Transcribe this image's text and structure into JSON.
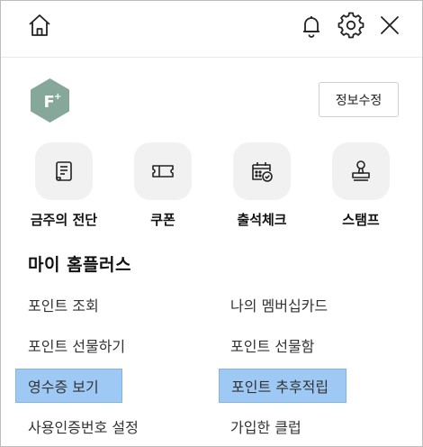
{
  "topbar": {
    "home_icon": "home-icon",
    "bell_icon": "bell-icon",
    "gear_icon": "gear-icon",
    "close_icon": "close-icon"
  },
  "profile": {
    "grade_badge_text": "F+",
    "badge_color": "#86a89a",
    "edit_label": "정보수정"
  },
  "shortcuts": [
    {
      "label": "금주의 전단",
      "icon": "flyer-scroll-icon"
    },
    {
      "label": "쿠폰",
      "icon": "coupon-icon"
    },
    {
      "label": "출석체크",
      "icon": "calendar-check-icon"
    },
    {
      "label": "스탬프",
      "icon": "stamp-icon"
    }
  ],
  "section": {
    "title": "마이 홈플러스"
  },
  "menu": {
    "left": [
      "포인트 조회",
      "포인트 선물하기",
      "영수증 보기",
      "사용인증번호 설정"
    ],
    "right": [
      "나의 멤버십카드",
      "포인트 선물함",
      "포인트 추후적립",
      "가입한 클럽"
    ]
  },
  "highlight_color": "#9ec9f4"
}
